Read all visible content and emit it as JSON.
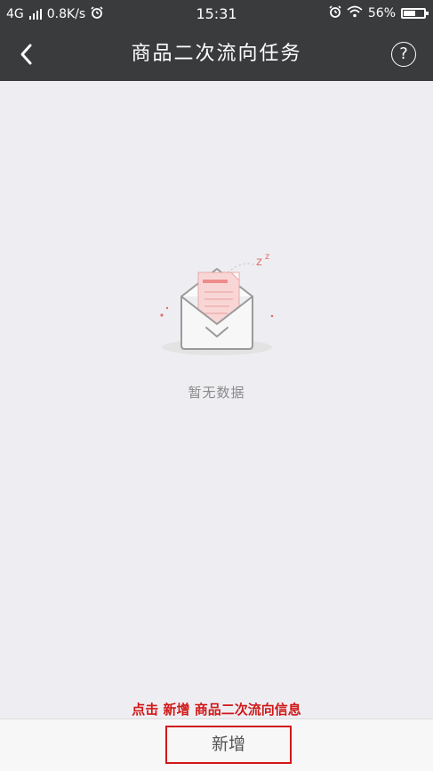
{
  "status_bar": {
    "network_type": "4G",
    "speed": "0.8K/s",
    "time": "15:31",
    "battery_percent": "56%",
    "battery_level": 0.56
  },
  "nav": {
    "title": "商品二次流向任务",
    "help_label": "?"
  },
  "empty_state": {
    "text": "暂无数据"
  },
  "hint": {
    "text": "点击 新增 商品二次流向信息"
  },
  "bottom": {
    "add_label": "新增"
  },
  "colors": {
    "header_bg": "#3a3b3c",
    "page_bg": "#eeeef2",
    "hint_red": "#d11818"
  }
}
